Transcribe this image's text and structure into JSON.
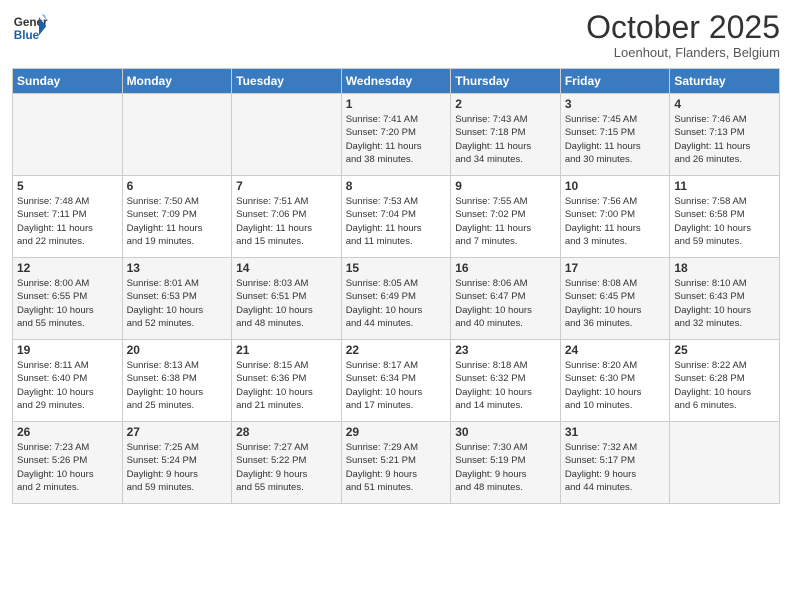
{
  "logo": {
    "line1": "General",
    "line2": "Blue"
  },
  "header": {
    "month": "October 2025",
    "location": "Loenhout, Flanders, Belgium"
  },
  "weekdays": [
    "Sunday",
    "Monday",
    "Tuesday",
    "Wednesday",
    "Thursday",
    "Friday",
    "Saturday"
  ],
  "weeks": [
    [
      {
        "day": "",
        "info": ""
      },
      {
        "day": "",
        "info": ""
      },
      {
        "day": "",
        "info": ""
      },
      {
        "day": "1",
        "info": "Sunrise: 7:41 AM\nSunset: 7:20 PM\nDaylight: 11 hours\nand 38 minutes."
      },
      {
        "day": "2",
        "info": "Sunrise: 7:43 AM\nSunset: 7:18 PM\nDaylight: 11 hours\nand 34 minutes."
      },
      {
        "day": "3",
        "info": "Sunrise: 7:45 AM\nSunset: 7:15 PM\nDaylight: 11 hours\nand 30 minutes."
      },
      {
        "day": "4",
        "info": "Sunrise: 7:46 AM\nSunset: 7:13 PM\nDaylight: 11 hours\nand 26 minutes."
      }
    ],
    [
      {
        "day": "5",
        "info": "Sunrise: 7:48 AM\nSunset: 7:11 PM\nDaylight: 11 hours\nand 22 minutes."
      },
      {
        "day": "6",
        "info": "Sunrise: 7:50 AM\nSunset: 7:09 PM\nDaylight: 11 hours\nand 19 minutes."
      },
      {
        "day": "7",
        "info": "Sunrise: 7:51 AM\nSunset: 7:06 PM\nDaylight: 11 hours\nand 15 minutes."
      },
      {
        "day": "8",
        "info": "Sunrise: 7:53 AM\nSunset: 7:04 PM\nDaylight: 11 hours\nand 11 minutes."
      },
      {
        "day": "9",
        "info": "Sunrise: 7:55 AM\nSunset: 7:02 PM\nDaylight: 11 hours\nand 7 minutes."
      },
      {
        "day": "10",
        "info": "Sunrise: 7:56 AM\nSunset: 7:00 PM\nDaylight: 11 hours\nand 3 minutes."
      },
      {
        "day": "11",
        "info": "Sunrise: 7:58 AM\nSunset: 6:58 PM\nDaylight: 10 hours\nand 59 minutes."
      }
    ],
    [
      {
        "day": "12",
        "info": "Sunrise: 8:00 AM\nSunset: 6:55 PM\nDaylight: 10 hours\nand 55 minutes."
      },
      {
        "day": "13",
        "info": "Sunrise: 8:01 AM\nSunset: 6:53 PM\nDaylight: 10 hours\nand 52 minutes."
      },
      {
        "day": "14",
        "info": "Sunrise: 8:03 AM\nSunset: 6:51 PM\nDaylight: 10 hours\nand 48 minutes."
      },
      {
        "day": "15",
        "info": "Sunrise: 8:05 AM\nSunset: 6:49 PM\nDaylight: 10 hours\nand 44 minutes."
      },
      {
        "day": "16",
        "info": "Sunrise: 8:06 AM\nSunset: 6:47 PM\nDaylight: 10 hours\nand 40 minutes."
      },
      {
        "day": "17",
        "info": "Sunrise: 8:08 AM\nSunset: 6:45 PM\nDaylight: 10 hours\nand 36 minutes."
      },
      {
        "day": "18",
        "info": "Sunrise: 8:10 AM\nSunset: 6:43 PM\nDaylight: 10 hours\nand 32 minutes."
      }
    ],
    [
      {
        "day": "19",
        "info": "Sunrise: 8:11 AM\nSunset: 6:40 PM\nDaylight: 10 hours\nand 29 minutes."
      },
      {
        "day": "20",
        "info": "Sunrise: 8:13 AM\nSunset: 6:38 PM\nDaylight: 10 hours\nand 25 minutes."
      },
      {
        "day": "21",
        "info": "Sunrise: 8:15 AM\nSunset: 6:36 PM\nDaylight: 10 hours\nand 21 minutes."
      },
      {
        "day": "22",
        "info": "Sunrise: 8:17 AM\nSunset: 6:34 PM\nDaylight: 10 hours\nand 17 minutes."
      },
      {
        "day": "23",
        "info": "Sunrise: 8:18 AM\nSunset: 6:32 PM\nDaylight: 10 hours\nand 14 minutes."
      },
      {
        "day": "24",
        "info": "Sunrise: 8:20 AM\nSunset: 6:30 PM\nDaylight: 10 hours\nand 10 minutes."
      },
      {
        "day": "25",
        "info": "Sunrise: 8:22 AM\nSunset: 6:28 PM\nDaylight: 10 hours\nand 6 minutes."
      }
    ],
    [
      {
        "day": "26",
        "info": "Sunrise: 7:23 AM\nSunset: 5:26 PM\nDaylight: 10 hours\nand 2 minutes."
      },
      {
        "day": "27",
        "info": "Sunrise: 7:25 AM\nSunset: 5:24 PM\nDaylight: 9 hours\nand 59 minutes."
      },
      {
        "day": "28",
        "info": "Sunrise: 7:27 AM\nSunset: 5:22 PM\nDaylight: 9 hours\nand 55 minutes."
      },
      {
        "day": "29",
        "info": "Sunrise: 7:29 AM\nSunset: 5:21 PM\nDaylight: 9 hours\nand 51 minutes."
      },
      {
        "day": "30",
        "info": "Sunrise: 7:30 AM\nSunset: 5:19 PM\nDaylight: 9 hours\nand 48 minutes."
      },
      {
        "day": "31",
        "info": "Sunrise: 7:32 AM\nSunset: 5:17 PM\nDaylight: 9 hours\nand 44 minutes."
      },
      {
        "day": "",
        "info": ""
      }
    ]
  ],
  "shaded_rows": [
    0,
    2,
    4
  ]
}
